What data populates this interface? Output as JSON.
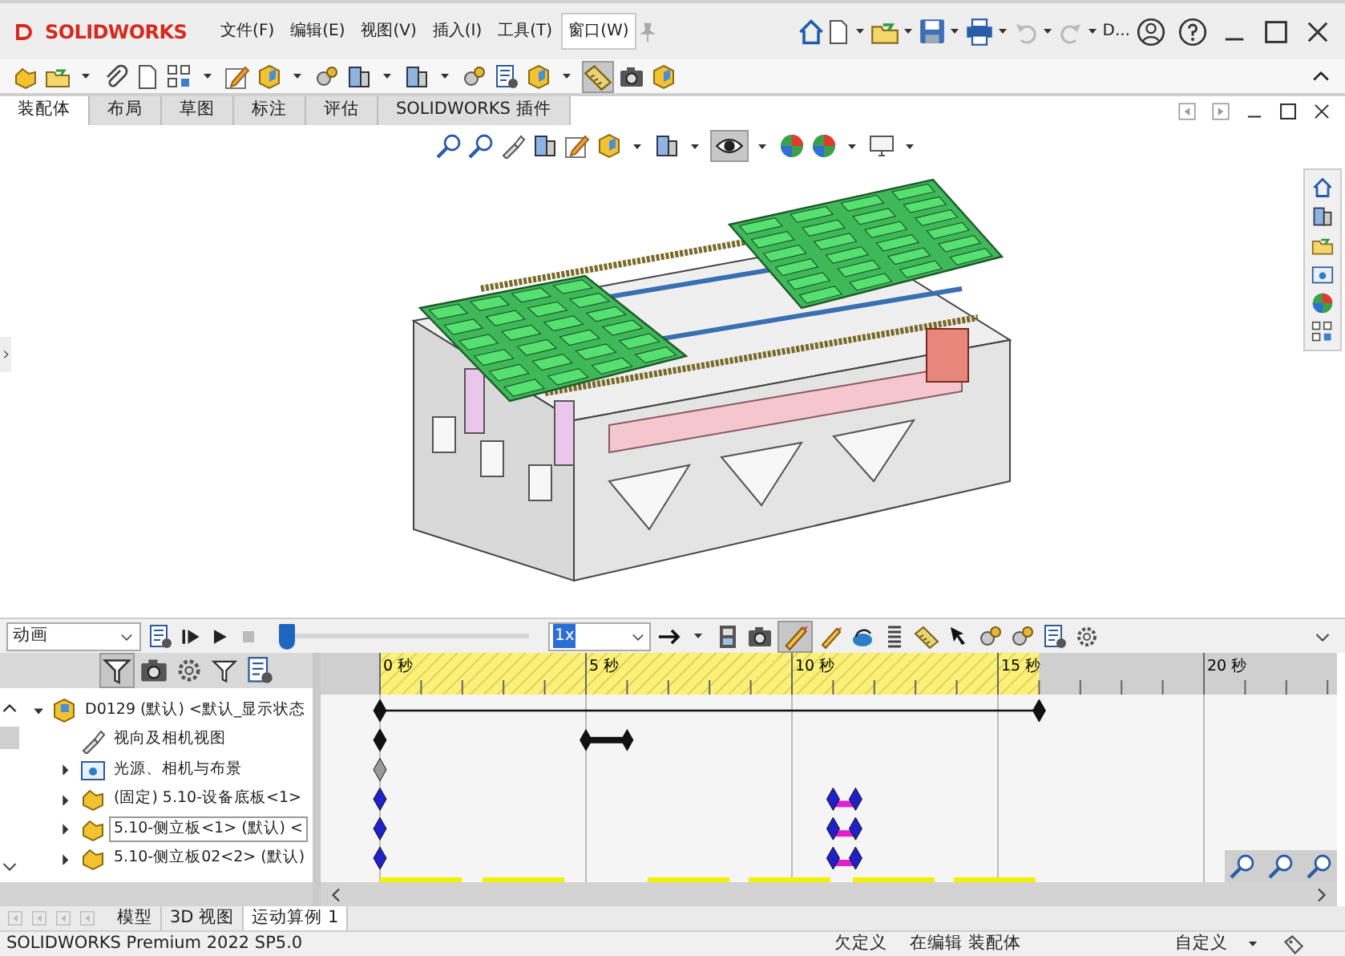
{
  "title_bar": {
    "app_name": "SOLIDWORKS",
    "menus": [
      {
        "label": "文件(F)",
        "selected": false
      },
      {
        "label": "编辑(E)",
        "selected": false
      },
      {
        "label": "视图(V)",
        "selected": false
      },
      {
        "label": "插入(I)",
        "selected": false
      },
      {
        "label": "工具(T)",
        "selected": false
      },
      {
        "label": "窗口(W)",
        "selected": true
      }
    ],
    "document_name": "D..."
  },
  "command_toolbar": {
    "measure_pressed": true
  },
  "command_tabs": [
    {
      "label": "装配体",
      "selected": true
    },
    {
      "label": "布局",
      "selected": false
    },
    {
      "label": "草图",
      "selected": false
    },
    {
      "label": "标注",
      "selected": false
    },
    {
      "label": "评估",
      "selected": false
    },
    {
      "label": "SOLIDWORKS 插件",
      "selected": false
    }
  ],
  "view_toolbar": {
    "display_style_pressed": true
  },
  "motion_toolbar": {
    "study_type": "动画",
    "level": 0,
    "playback_speed": "1x",
    "autokey_on": true
  },
  "tree_filter": {
    "filter_on": true
  },
  "feature_tree": [
    {
      "label": "D0129 (默认) <默认_显示状态",
      "kind": "assembly",
      "expanded": true,
      "selected": false,
      "children": [
        {
          "label": "视向及相机视图",
          "kind": "camera",
          "selected": false
        },
        {
          "label": "光源、相机与布景",
          "kind": "lights",
          "expanded": false,
          "selected": false
        },
        {
          "label": "(固定) 5.10-设备底板<1>",
          "kind": "part",
          "expanded": false,
          "selected": false
        },
        {
          "label": "5.10-侧立板<1> (默认) <",
          "kind": "part",
          "expanded": false,
          "selected": true
        },
        {
          "label": "5.10-侧立板02<2> (默认)",
          "kind": "part",
          "expanded": false,
          "selected": false
        }
      ]
    }
  ],
  "timeline": {
    "ticks": [
      "0 秒",
      "5 秒",
      "10 秒",
      "15 秒",
      "20 秒"
    ]
  },
  "bottom_tabs": [
    {
      "label": "模型",
      "selected": false
    },
    {
      "label": "3D 视图",
      "selected": false
    },
    {
      "label": "运动算例 1",
      "selected": true
    }
  ],
  "status_bar": {
    "product": "SOLIDWORKS Premium 2022 SP5.0",
    "sketch_state": "欠定义",
    "mode": "在编辑 装配体",
    "units": "自定义"
  }
}
